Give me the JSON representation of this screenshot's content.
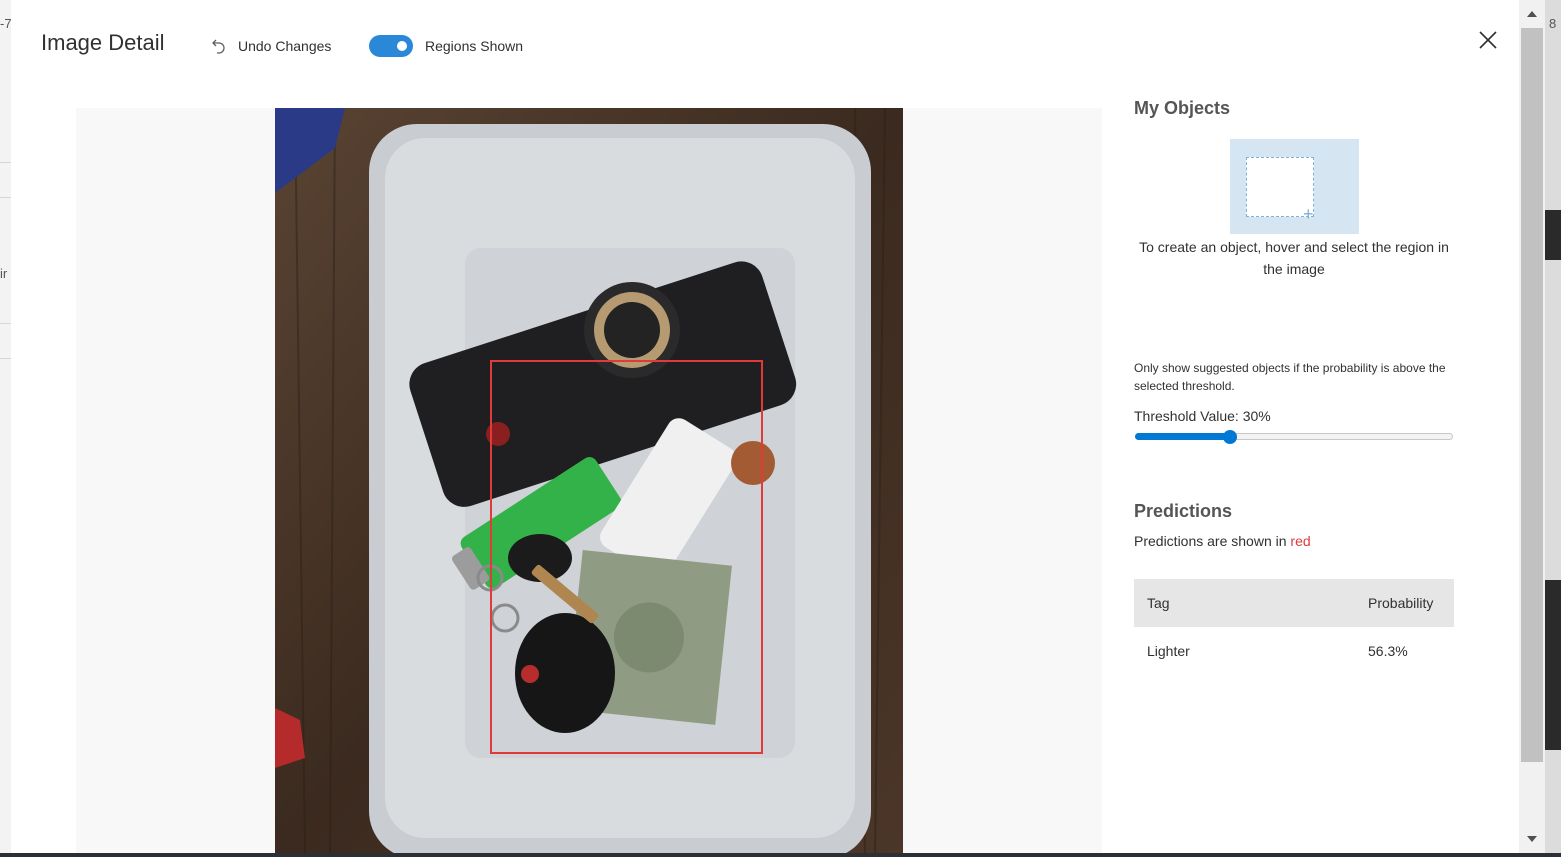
{
  "background": {
    "left_fragments": [
      "-7",
      "ir"
    ],
    "right_fragments": [
      "8"
    ]
  },
  "header": {
    "title": "Image Detail",
    "undo_label": "Undo Changes",
    "undo_icon": "undo-icon",
    "regions_toggle_label": "Regions Shown",
    "regions_toggle_on": true,
    "close_icon": "close-icon"
  },
  "image": {
    "description_icon": "photo",
    "prediction_region_color": "#e03a3a"
  },
  "panel": {
    "my_objects_title": "My Objects",
    "create_hint": "To create an object, hover and select the region in the image",
    "threshold_note": "Only show suggested objects if the probability is above the selected threshold.",
    "threshold_label": "Threshold Value: 30%",
    "threshold_value": 0.3,
    "predictions_title": "Predictions",
    "predictions_note_prefix": "Predictions are shown in ",
    "predictions_note_color_word": "red",
    "table": {
      "headers": [
        "Tag",
        "Probability"
      ],
      "rows": [
        {
          "tag": "Lighter",
          "probability": "56.3%"
        }
      ]
    }
  },
  "colors": {
    "accent": "#0078d4",
    "toggle": "#2b88d8",
    "prediction": "#e03a3a"
  }
}
